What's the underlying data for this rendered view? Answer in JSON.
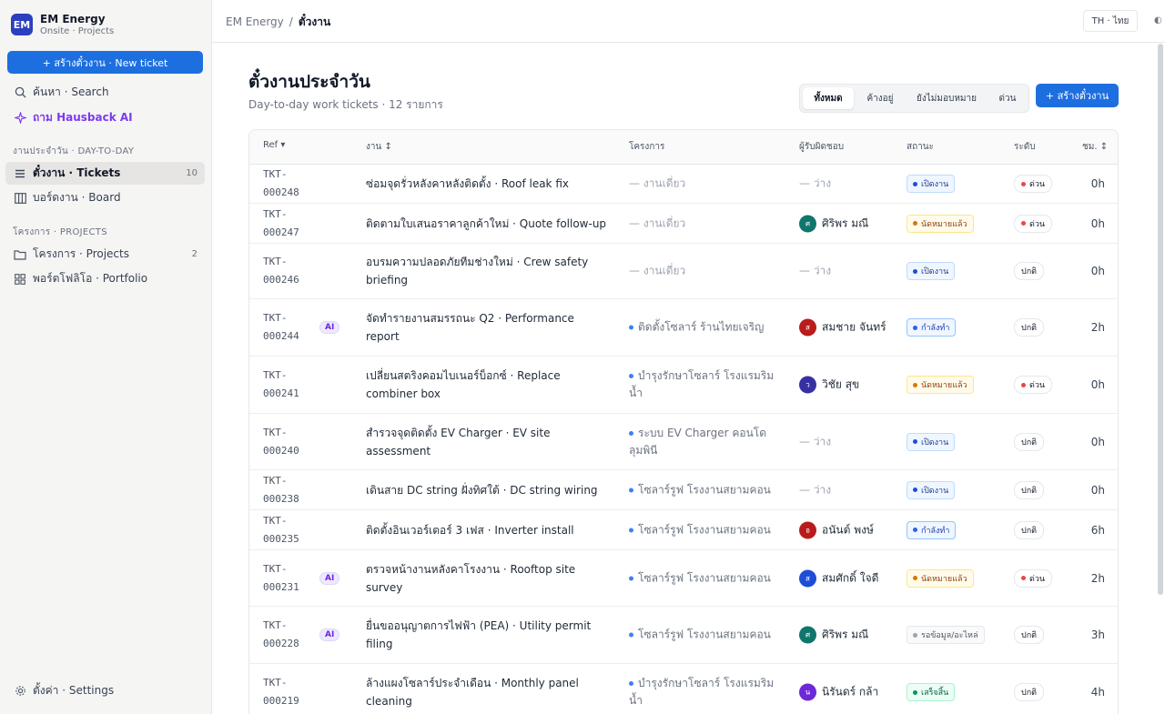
{
  "brand": {
    "logo": "EM",
    "name": "EM Energy",
    "subtitle": "Onsite · Projects"
  },
  "sidebar": {
    "new_ticket_label": "+ สร้างตั๋วงาน · New ticket",
    "search_label": "ค้นหา · Search",
    "ai_label": "ถาม Hausback AI",
    "section_daily": "งานประจำวัน · DAY-TO-DAY",
    "tickets_label": "ตั๋วงาน · Tickets",
    "tickets_count": "10",
    "board_label": "บอร์ดงาน · Board",
    "section_projects": "โครงการ · PROJECTS",
    "projects_label": "โครงการ · Projects",
    "projects_count": "2",
    "portfolio_label": "พอร์ตโฟลิโอ · Portfolio",
    "settings_label": "ตั้งค่า · Settings"
  },
  "topbar": {
    "crumb_root": "EM Energy",
    "crumb_sep": "/",
    "crumb_current": "ตั๋วงาน",
    "lang_label": "TH · ไทย"
  },
  "page": {
    "title": "ตั๋วงานประจำวัน",
    "subtitle": "Day-to-day work tickets · 12 รายการ",
    "create_label": "+ สร้างตั๋วงาน"
  },
  "filters": {
    "all": "ทั้งหมด",
    "pending": "ค้างอยู่",
    "unassigned": "ยังไม่มอบหมาย",
    "urgent": "ด่วน"
  },
  "columns": {
    "ref": "Ref ▾",
    "task": "งาน ↕",
    "project": "โครงการ",
    "owner": "ผู้รับผิดชอบ",
    "status": "สถานะ",
    "priority": "ระดับ",
    "hours": "ชม. ↕"
  },
  "colors": {
    "accent": "#1d6fe0",
    "ai": "#7c3aed"
  },
  "rows": [
    {
      "ref": "TKT-000248",
      "ai": "",
      "task": "ซ่อมจุดรั่วหลังคาหลังติดตั้ง · Roof leak fix",
      "project": "— งานเดี่ยว",
      "owner": "— ว่าง",
      "avatar": "",
      "avatar_color": "",
      "status": "เปิดงาน",
      "status_kind": "open",
      "priority": "ด่วน",
      "urgent": true,
      "hours": "0h"
    },
    {
      "ref": "TKT-000247",
      "ai": "",
      "task": "ติดตามใบเสนอราคาลูกค้าใหม่ · Quote follow-up",
      "project": "— งานเดี่ยว",
      "owner": "ศิริพร มณี",
      "avatar": "ศ",
      "avatar_color": "#0f766e",
      "status": "นัดหมายแล้ว",
      "status_kind": "scheduled",
      "priority": "ด่วน",
      "urgent": true,
      "hours": "0h"
    },
    {
      "ref": "TKT-000246",
      "ai": "",
      "task": "อบรมความปลอดภัยทีมช่างใหม่ · Crew safety briefing",
      "project": "— งานเดี่ยว",
      "owner": "— ว่าง",
      "avatar": "",
      "avatar_color": "",
      "status": "เปิดงาน",
      "status_kind": "open",
      "priority": "ปกติ",
      "urgent": false,
      "hours": "0h"
    },
    {
      "ref": "TKT-000244",
      "ai": "AI",
      "task": "จัดทำรายงานสมรรถนะ Q2 · Performance report",
      "project": "ติดตั้งโซลาร์ ร้านไทยเจริญ",
      "owner": "สมชาย จันทร์",
      "avatar": "ส",
      "avatar_color": "#b91c1c",
      "status": "กำลังทำ",
      "status_kind": "progress",
      "priority": "ปกติ",
      "urgent": false,
      "hours": "2h"
    },
    {
      "ref": "TKT-000241",
      "ai": "",
      "task": "เปลี่ยนสตริงคอมไบเนอร์บ็อกซ์ · Replace combiner box",
      "project": "บำรุงรักษาโซลาร์ โรงแรมริมน้ำ",
      "owner": "วิชัย สุข",
      "avatar": "ว",
      "avatar_color": "#3730a3",
      "status": "นัดหมายแล้ว",
      "status_kind": "scheduled",
      "priority": "ด่วน",
      "urgent": true,
      "hours": "0h"
    },
    {
      "ref": "TKT-000240",
      "ai": "",
      "task": "สำรวจจุดติดตั้ง EV Charger · EV site assessment",
      "project": "ระบบ EV Charger คอนโด ลุมพินี",
      "owner": "— ว่าง",
      "avatar": "",
      "avatar_color": "",
      "status": "เปิดงาน",
      "status_kind": "open",
      "priority": "ปกติ",
      "urgent": false,
      "hours": "0h"
    },
    {
      "ref": "TKT-000238",
      "ai": "",
      "task": "เดินสาย DC string ฝั่งทิศใต้ · DC string wiring",
      "project": "โซลาร์รูฟ โรงงานสยามคอน",
      "owner": "— ว่าง",
      "avatar": "",
      "avatar_color": "",
      "status": "เปิดงาน",
      "status_kind": "open",
      "priority": "ปกติ",
      "urgent": false,
      "hours": "0h"
    },
    {
      "ref": "TKT-000235",
      "ai": "",
      "task": "ติดตั้งอินเวอร์เตอร์ 3 เฟส · Inverter install",
      "project": "โซลาร์รูฟ โรงงานสยามคอน",
      "owner": "อนันต์ พงษ์",
      "avatar": "อ",
      "avatar_color": "#b91c1c",
      "status": "กำลังทำ",
      "status_kind": "progress",
      "priority": "ปกติ",
      "urgent": false,
      "hours": "6h"
    },
    {
      "ref": "TKT-000231",
      "ai": "AI",
      "task": "ตรวจหน้างานหลังคาโรงงาน · Rooftop site survey",
      "project": "โซลาร์รูฟ โรงงานสยามคอน",
      "owner": "สมศักดิ์ ใจดี",
      "avatar": "ส",
      "avatar_color": "#1d4ed8",
      "status": "นัดหมายแล้ว",
      "status_kind": "scheduled",
      "priority": "ด่วน",
      "urgent": true,
      "hours": "2h"
    },
    {
      "ref": "TKT-000228",
      "ai": "AI",
      "task": "ยื่นขออนุญาตการไฟฟ้า (PEA) · Utility permit filing",
      "project": "โซลาร์รูฟ โรงงานสยามคอน",
      "owner": "ศิริพร มณี",
      "avatar": "ศ",
      "avatar_color": "#0f766e",
      "status": "รอข้อมูล/อะไหล่",
      "status_kind": "waiting",
      "priority": "ปกติ",
      "urgent": false,
      "hours": "3h"
    },
    {
      "ref": "TKT-000219",
      "ai": "",
      "task": "ล้างแผงโซลาร์ประจำเดือน · Monthly panel cleaning",
      "project": "บำรุงรักษาโซลาร์ โรงแรมริมน้ำ",
      "owner": "นิรันดร์ กล้า",
      "avatar": "น",
      "avatar_color": "#6d28d9",
      "status": "เสร็จสิ้น",
      "status_kind": "done",
      "priority": "ปกติ",
      "urgent": false,
      "hours": "4h"
    }
  ]
}
